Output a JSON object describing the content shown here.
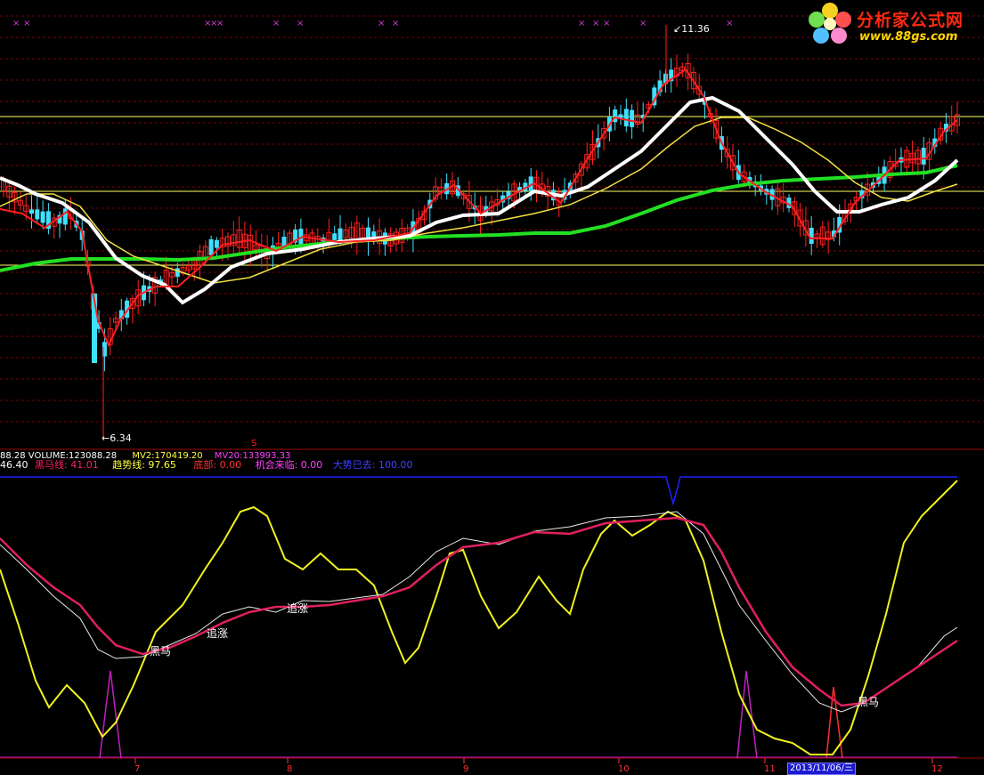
{
  "upper_panel": {
    "high_label": "11.36",
    "low_label": "6.34",
    "marker_s": "S"
  },
  "volume_bar": {
    "volume_label": "88.28  VOLUME:123088.28",
    "mv2_label": "MV2:170419.20",
    "mv20_label": "MV20:133993.33"
  },
  "indicator_bar": {
    "prefix": "46.40",
    "heima": "黑马线: 41.01",
    "qushi": "趋势线: 97.65",
    "dibu": "底部: 0.00",
    "jihui": "机会来临: 0.00",
    "dashi": "大势已去: 100.00"
  },
  "lower_panel": {
    "labels": [
      "黑马",
      "追涨",
      "追涨",
      "黑马"
    ]
  },
  "x_axis": {
    "ticks": [
      "7",
      "8",
      "9",
      "10",
      "11",
      "12"
    ],
    "current_date": "2013/11/06/三"
  },
  "logo": {
    "title": "分析家公式网",
    "url": "www.88gs.com"
  },
  "colors": {
    "background": "#000000",
    "grid": "#7a0000",
    "up_candle": "#ff2020",
    "down_candle": "#40e0ff",
    "ma_white": "#ffffff",
    "ma_yellow": "#f0e040",
    "ma_green": "#22e022",
    "heima_line": "#e0205a",
    "qushi_line": "#f0f020",
    "signal_purple": "#c020c0",
    "blue_line": "#2020ff"
  }
}
